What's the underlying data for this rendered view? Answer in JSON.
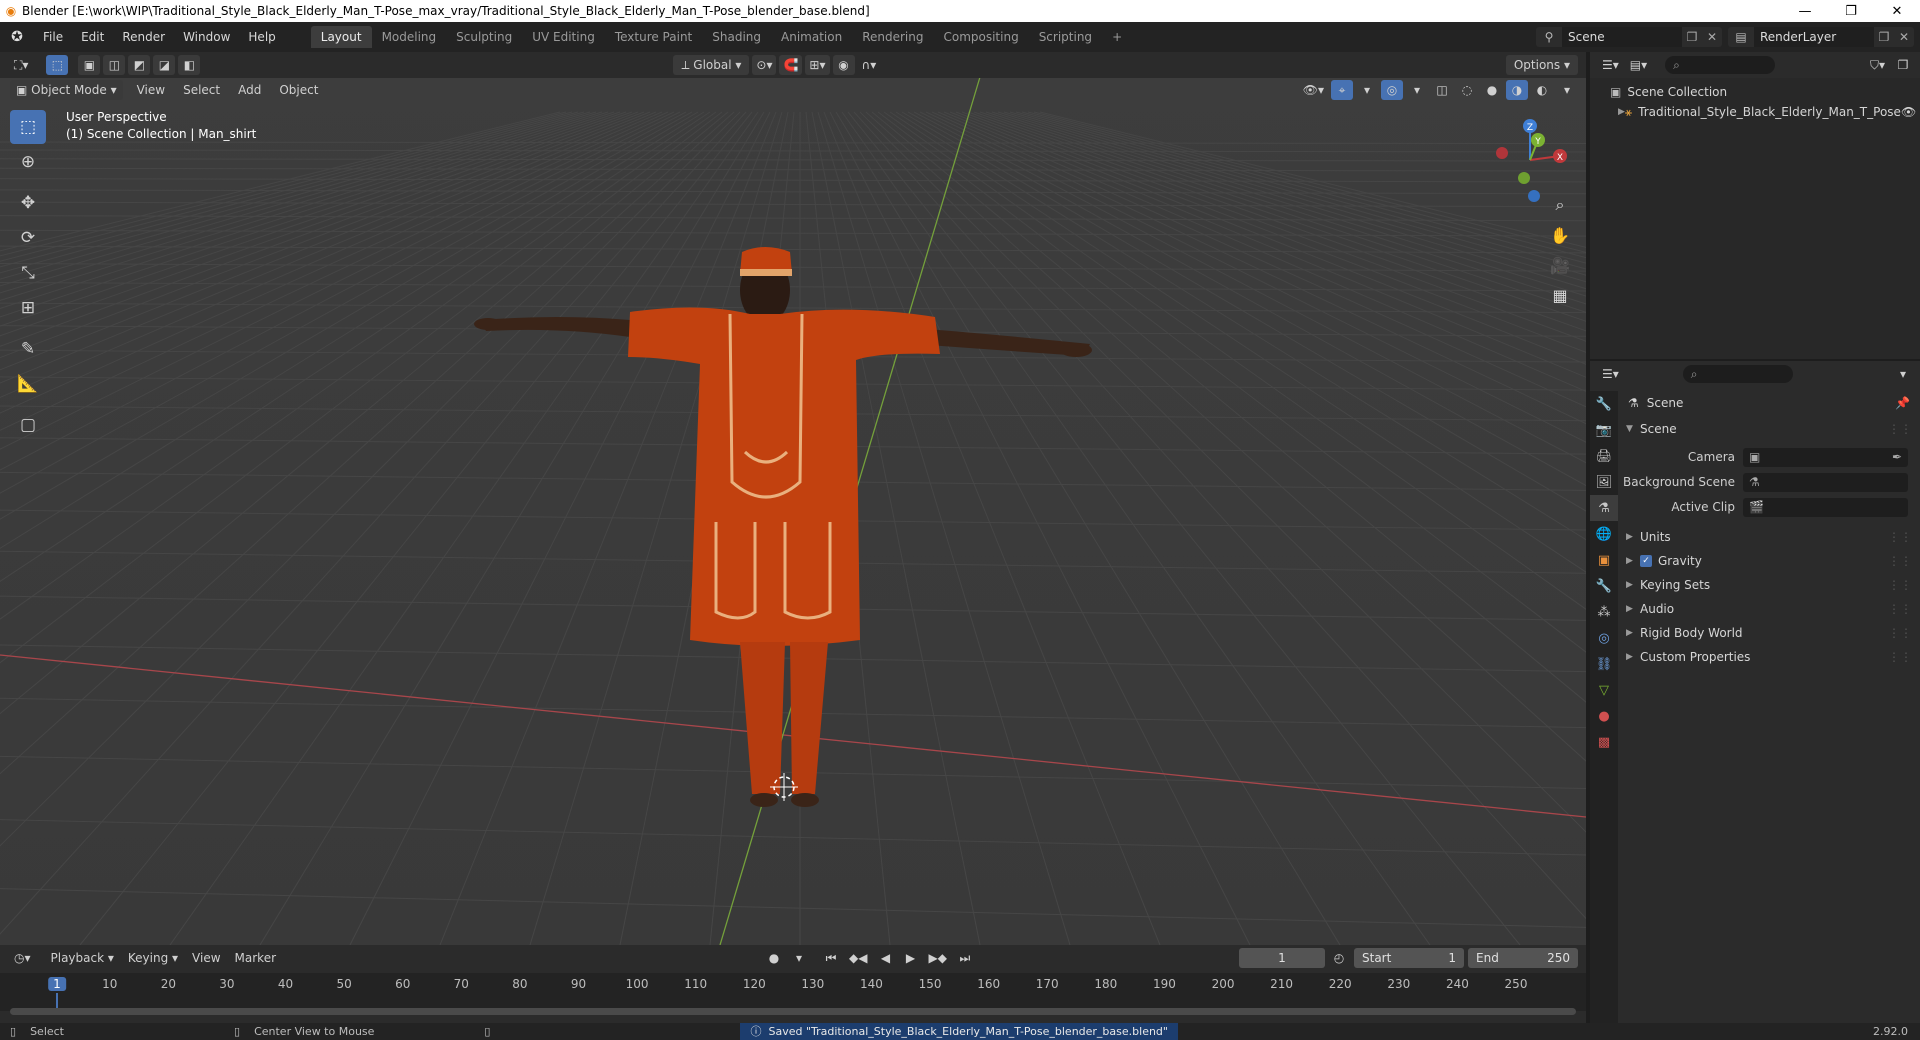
{
  "window": {
    "title": "Blender [E:\\work\\WIP\\Traditional_Style_Black_Elderly_Man_T-Pose_max_vray/Traditional_Style_Black_Elderly_Man_T-Pose_blender_base.blend]"
  },
  "menu": [
    "File",
    "Edit",
    "Render",
    "Window",
    "Help"
  ],
  "workspaces": [
    "Layout",
    "Modeling",
    "Sculpting",
    "UV Editing",
    "Texture Paint",
    "Shading",
    "Animation",
    "Rendering",
    "Compositing",
    "Scripting"
  ],
  "active_workspace": "Layout",
  "scene_selector": "Scene",
  "view_layer_selector": "RenderLayer",
  "viewport": {
    "transform_orientation": "Global",
    "options_label": "Options",
    "mode": "Object Mode",
    "menus": [
      "View",
      "Select",
      "Add",
      "Object"
    ],
    "info_line1": "User Perspective",
    "info_line2": "(1) Scene Collection | Man_shirt",
    "gizmo_labels": {
      "z": "Z",
      "y": "Y",
      "x": "X"
    }
  },
  "outliner": {
    "root": "Scene Collection",
    "items": [
      "Traditional_Style_Black_Elderly_Man_T_Pose"
    ]
  },
  "properties": {
    "context": "Scene",
    "section": "Scene",
    "fields": [
      {
        "label": "Camera",
        "value": ""
      },
      {
        "label": "Background Scene",
        "value": ""
      },
      {
        "label": "Active Clip",
        "value": ""
      }
    ],
    "panels": [
      {
        "label": "Units",
        "checkbox": false
      },
      {
        "label": "Gravity",
        "checkbox": true
      },
      {
        "label": "Keying Sets",
        "checkbox": false
      },
      {
        "label": "Audio",
        "checkbox": false
      },
      {
        "label": "Rigid Body World",
        "checkbox": false
      },
      {
        "label": "Custom Properties",
        "checkbox": false
      }
    ]
  },
  "timeline": {
    "menus": [
      "Playback",
      "Keying",
      "View",
      "Marker"
    ],
    "current_frame": "1",
    "start_label": "Start",
    "start": "1",
    "end_label": "End",
    "end": "250",
    "ticks": [
      "1",
      "10",
      "20",
      "30",
      "40",
      "50",
      "60",
      "70",
      "80",
      "90",
      "100",
      "110",
      "120",
      "130",
      "140",
      "150",
      "160",
      "170",
      "180",
      "190",
      "200",
      "210",
      "220",
      "230",
      "240",
      "250"
    ]
  },
  "statusbar": {
    "left1": "Select",
    "left2": "Center View to Mouse",
    "message": "Saved \"Traditional_Style_Black_Elderly_Man_T-Pose_blender_base.blend\"",
    "version": "2.92.0"
  },
  "colors": {
    "accent": "#4772b3",
    "x_axis": "#c0393b",
    "y_axis": "#7bb232",
    "z_axis": "#3f7fd6",
    "outfit": "#c2410f"
  }
}
